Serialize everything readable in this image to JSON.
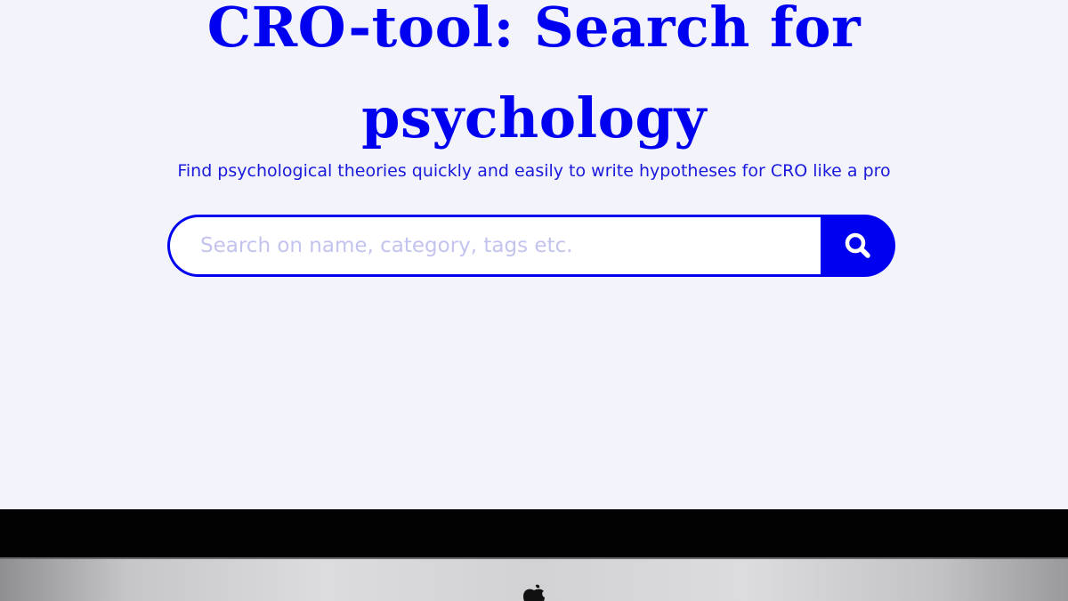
{
  "hero": {
    "title_line1": "CRO-tool: Search for",
    "title_line2": "psychology",
    "subtitle": "Find psychological theories quickly and easily to write hypotheses for CRO like a pro"
  },
  "search": {
    "placeholder": "Search on name, category, tags etc.",
    "value": "",
    "button_icon": "search-icon"
  },
  "device": {
    "logo_icon": "apple-logo-icon"
  },
  "colors": {
    "accent": "#0000f0",
    "background": "#f3f3fc",
    "subtitle": "#1a1adc",
    "placeholder": "#c3c3ef"
  }
}
